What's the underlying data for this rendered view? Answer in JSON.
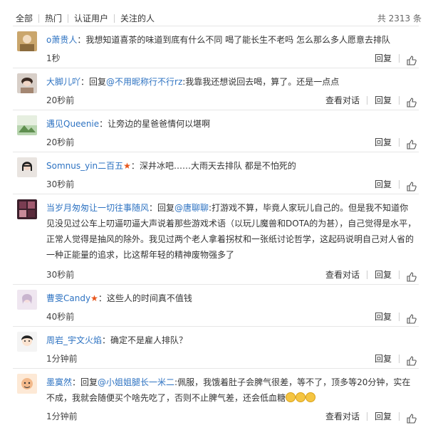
{
  "tabs": [
    "全部",
    "热门",
    "认证用户",
    "关注的人"
  ],
  "total": "共 2313 条",
  "actions": {
    "view": "查看对话",
    "reply": "回复"
  },
  "comments": [
    {
      "user": "o萧贵人",
      "colon": "：",
      "text": "我想知道喜茶的味道到底有什么不同 喝了能长生不老吗 怎么那么多人愿意去排队",
      "time": "1秒",
      "view": false
    },
    {
      "user": "大脚儿吖",
      "colon": "：回复",
      "at": "@不用昵称行不行rz",
      "text": ":我靠我还想说回去喝，算了。还是一点点",
      "time": "20秒前",
      "view": true
    },
    {
      "user": "遇见Queenie",
      "colon": "：",
      "text": "让旁边的星爸爸情何以堪啊",
      "time": "20秒前",
      "view": false
    },
    {
      "user": "Somnus_yin二百五",
      "star": "★",
      "colon": "：",
      "text": "深井冰吧……大雨天去排队 都是不怕死的",
      "time": "30秒前",
      "view": false
    },
    {
      "user": "当岁月匆匆让一切往事随风",
      "colon": "：回复",
      "at": "@唐聊聊",
      "text": ":打游戏不算，毕竟人家玩儿自己的。但是我不知道你见没见过公车上叨逼叨逼大声说着那些游戏术语（以玩儿魔兽和DOTA的为甚），自己觉得是水平，正常人觉得是抽风的除外。我见过两个老人拿着拐杖和一张纸讨论哲学，这起码说明自己对人省的一种正能量的追求，比这帮年轻的精神废物强多了",
      "time": "30秒前",
      "view": true
    },
    {
      "user": "曹雯Candy",
      "star": "★",
      "colon": "：",
      "text": "这些人的时间真不值钱",
      "time": "40秒前",
      "view": false
    },
    {
      "user": "周岩_宇文火焰",
      "colon": "：",
      "text": "确定不是雇人排队？",
      "time": "1分钟前",
      "view": false
    },
    {
      "user": "墨寞然",
      "colon": "：回复",
      "at": "@小姐姐腿长一米二",
      "text": ":佩服，我饿着肚子会脾气很差，等不了，顶多等20分钟，实在不成，我就会随便买个啥先吃了，否则不止脾气差，还会低血糖",
      "time": "1分钟前",
      "view": true
    }
  ]
}
